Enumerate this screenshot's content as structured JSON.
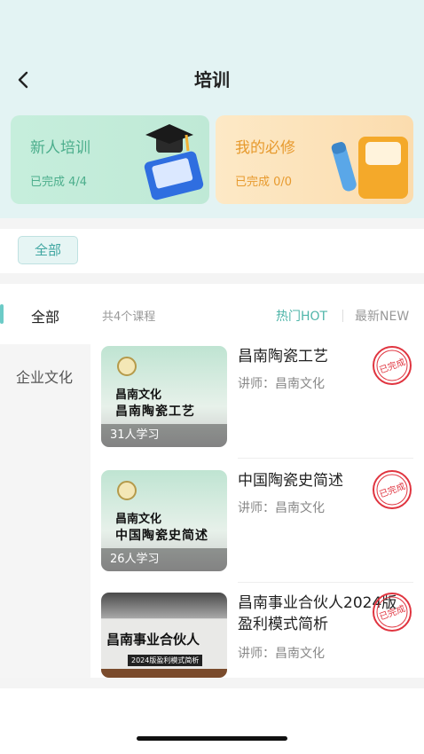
{
  "header": {
    "title": "培训",
    "back_icon": "chevron-left-icon"
  },
  "cards": [
    {
      "title": "新人培训",
      "progress": "已完成 4/4",
      "color": "#4cae8c",
      "icon": "graduation-book-icon"
    },
    {
      "title": "我的必修",
      "progress": "已完成 0/0",
      "color": "#e79a2e",
      "icon": "notebook-pen-icon"
    }
  ],
  "filter": {
    "chip_label": "全部"
  },
  "categories": {
    "selected": "全部",
    "items": [
      "企业文化"
    ]
  },
  "list": {
    "count_text": "共4个课程",
    "sort_hot": "热门HOT",
    "sort_new": "最新NEW",
    "accent": "#4fb5a9"
  },
  "courses": [
    {
      "title": "昌南陶瓷工艺",
      "teacher": "讲师：昌南文化",
      "thumb_line1": "昌南文化",
      "thumb_line2": "昌南陶瓷工艺",
      "learners": "31人学习",
      "stamp": "已完成"
    },
    {
      "title": "中国陶瓷史简述",
      "teacher": "讲师：昌南文化",
      "thumb_line1": "昌南文化",
      "thumb_line2": "中国陶瓷史简述",
      "learners": "26人学习",
      "stamp": "已完成"
    },
    {
      "title": "昌南事业合伙人2024版盈利模式简析",
      "teacher": "讲师：昌南文化",
      "thumb_big": "昌南事业合伙人",
      "thumb_tag": "2024版盈利模式简析",
      "stamp": "已完成"
    }
  ]
}
